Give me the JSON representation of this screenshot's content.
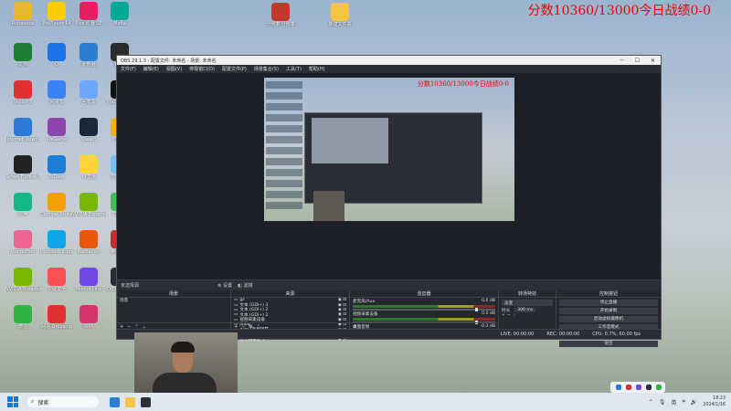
{
  "score_overlay": "分数10360/13000今日战绩0-0",
  "desktop_icons": [
    {
      "label": "Rshadeca",
      "color": "#e8b730"
    },
    {
      "label": "PotPlayer 64",
      "color": "#ffcc00"
    },
    {
      "label": "Pics 原画 SE",
      "color": "#e81e63"
    },
    {
      "label": "Mafia",
      "color": "#00a896"
    },
    {
      "label": "文档",
      "color": "#1e7e34"
    },
    {
      "label": "Q",
      "color": "#1a73e8"
    },
    {
      "label": "此电脑",
      "color": "#2d7dd2"
    },
    {
      "label": "LIVE",
      "color": "#2c2c2c"
    },
    {
      "label": "Vector 3",
      "color": "#e03131"
    },
    {
      "label": "网易云",
      "color": "#3b82f6"
    },
    {
      "label": "回收站",
      "color": "#6ea8fe"
    },
    {
      "label": "Xbox Game",
      "color": "#111"
    },
    {
      "label": "Internet Downloa...",
      "color": "#2b7bd6"
    },
    {
      "label": "WeGame",
      "color": "#8e44ad"
    },
    {
      "label": "Steam",
      "color": "#1b2838"
    },
    {
      "label": "YY语音",
      "color": "#fab005"
    },
    {
      "label": "Street Fighter 6",
      "color": "#222"
    },
    {
      "label": "ToDesk",
      "color": "#1c7ed6"
    },
    {
      "label": "YY直播",
      "color": "#ffd43b"
    },
    {
      "label": "控制面板",
      "color": "#74c0fc"
    },
    {
      "label": "雷神",
      "color": "#12b886"
    },
    {
      "label": "Counter-Strike",
      "color": "#f59f00"
    },
    {
      "label": "NVIDIA Experience",
      "color": "#76b900"
    },
    {
      "label": "CODX",
      "color": "#40c057"
    },
    {
      "label": "MangoFam",
      "color": "#f06595"
    },
    {
      "label": "Microsoft Edge",
      "color": "#0ea5e9"
    },
    {
      "label": "Battle.net",
      "color": "#e8590c"
    },
    {
      "label": "英雄联盟",
      "color": "#c92a2a"
    },
    {
      "label": "NVIDIA Broadcast",
      "color": "#76b900"
    },
    {
      "label": "火绒安全",
      "color": "#fa5252"
    },
    {
      "label": "Moono Link",
      "color": "#7048e8"
    },
    {
      "label": "OBS Studio",
      "color": "#2b2e38"
    },
    {
      "label": "微信",
      "color": "#2fb344"
    },
    {
      "label": "网易 Dropship",
      "color": "#e03131"
    },
    {
      "label": "WPS",
      "color": "#d6336c"
    }
  ],
  "top_files": [
    {
      "label": "分辨率 分辨率",
      "color": "#c0392b"
    },
    {
      "label": "新建文件夹",
      "color": "#f4c542"
    }
  ],
  "obs": {
    "title": "OBS 29.1.3 - 配置文件: 未命名 - 场景: 未命名",
    "menu": [
      "文件(F)",
      "编辑(E)",
      "视图(V)",
      "停靠窗口(D)",
      "配置文件(P)",
      "场景集合(S)",
      "工具(T)",
      "帮助(H)"
    ],
    "toolbar": {
      "source_label": "未选择源",
      "settings": "设置",
      "filters": "滤镜"
    },
    "docks": {
      "scenes": {
        "title": "场景",
        "items": [
          "场景"
        ]
      },
      "sources": {
        "title": "来源",
        "items": [
          "gz",
          "文本 (GDI+) 3",
          "文本 (GDI+) 2",
          "文本 (GDI+) 2",
          "视频采集设备",
          "jiubg",
          "dota2专用捕获",
          "cogo1",
          "显示器采集 2"
        ]
      },
      "mixer": {
        "title": "混音器",
        "channels": [
          {
            "name": "麦克风/Aux",
            "db": "0.0 dB"
          },
          {
            "name": "视频采集设备",
            "db": "0.0 dB"
          },
          {
            "name": "桌面音频",
            "db": "-0.3 dB"
          }
        ]
      },
      "transitions": {
        "title": "转场特效",
        "type": "淡变",
        "duration_label": "时长",
        "duration": "300 ms"
      },
      "controls": {
        "title": "控制按钮",
        "buttons": [
          "停止直播",
          "开始录制",
          "启动虚拟摄像机",
          "工作室模式",
          "设置",
          "退出"
        ]
      }
    },
    "status": {
      "live": "LIVE: 00:00:00",
      "rec": "REC: 00:00:00",
      "cpu": "CPU: 0.7%, 60.00 fps"
    }
  },
  "taskbar": {
    "search_placeholder": "搜索",
    "tray_lang": "英",
    "time": "18:23",
    "date": "2024/1/16"
  }
}
